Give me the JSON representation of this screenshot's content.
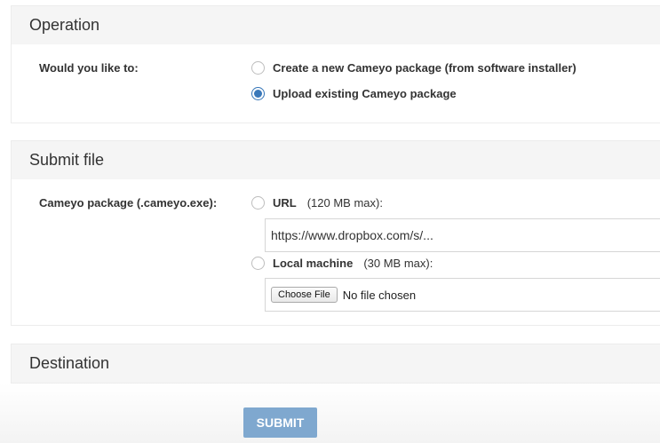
{
  "operation": {
    "title": "Operation",
    "question_label": "Would you like to:",
    "options": [
      {
        "label": "Create a new Cameyo package (from software installer)",
        "checked": false
      },
      {
        "label": "Upload existing Cameyo package",
        "checked": true
      }
    ]
  },
  "submit_file": {
    "title": "Submit file",
    "package_label": "Cameyo package (.cameyo.exe):",
    "url_option": {
      "label": "URL",
      "note": "(120 MB max):",
      "checked": false
    },
    "url_input": {
      "value": "https://www.dropbox.com/s/..."
    },
    "local_option": {
      "label": "Local machine",
      "note": "(30 MB max):",
      "checked": false
    },
    "file_input": {
      "button_label": "Choose File",
      "status": "No file chosen"
    }
  },
  "destination": {
    "title": "Destination"
  },
  "submit": {
    "label": "SUBMIT"
  }
}
